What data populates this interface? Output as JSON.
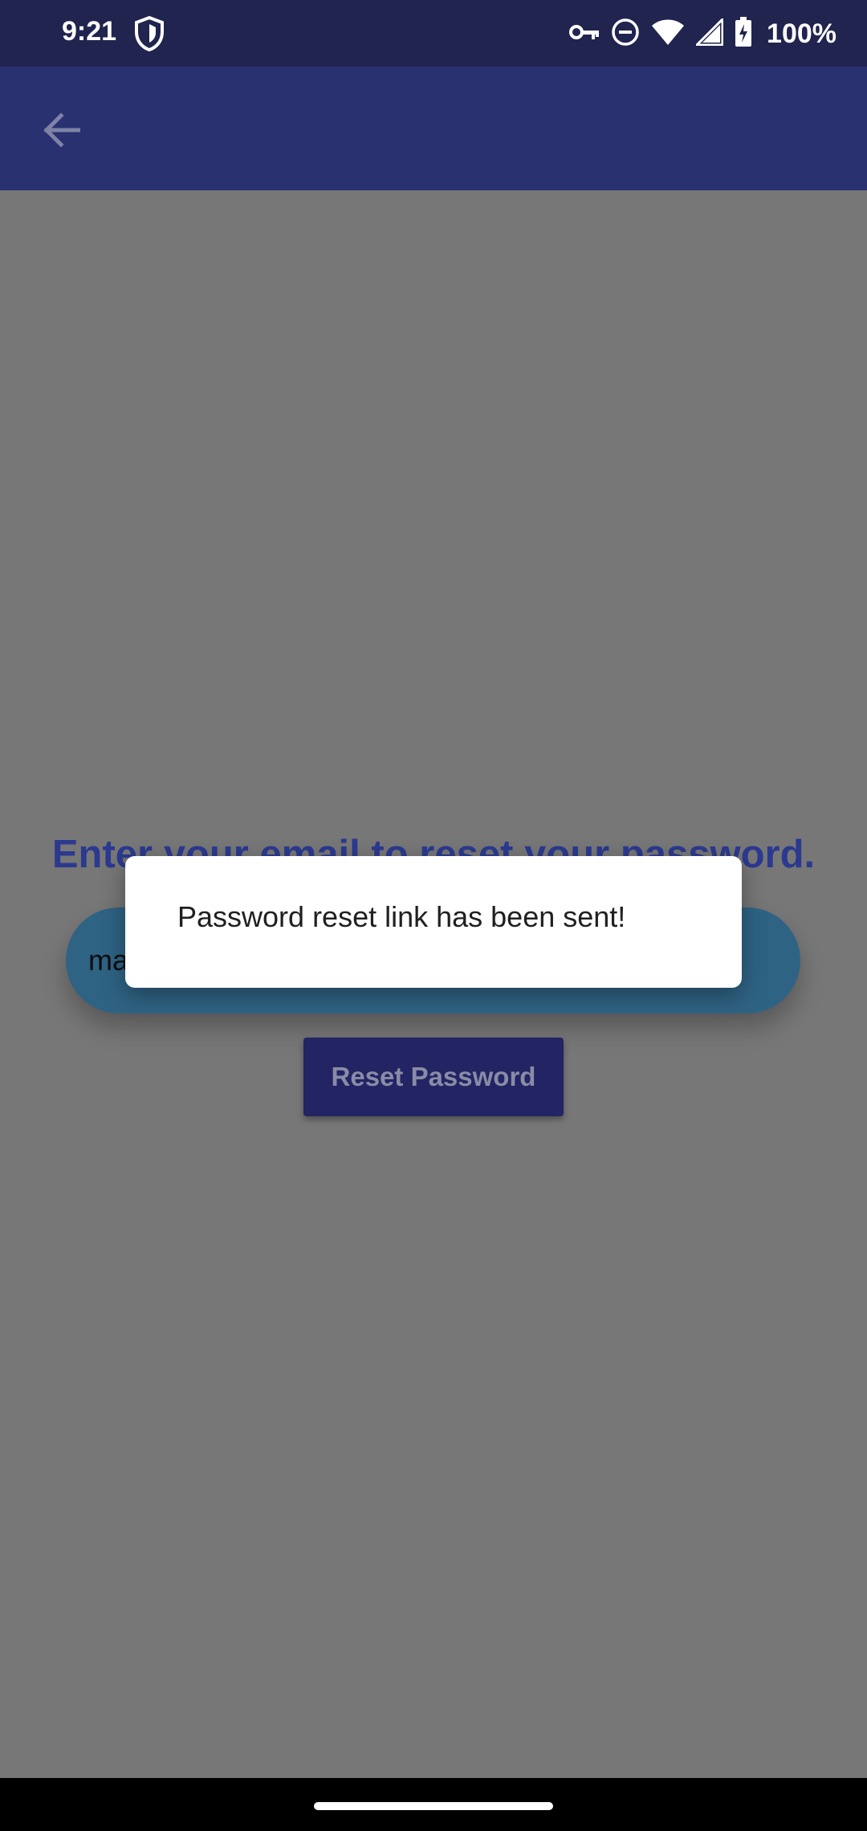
{
  "status_bar": {
    "time": "9:21",
    "battery_percent": "100%",
    "icons": [
      "shield-icon",
      "vpn-key-icon",
      "do-not-disturb-icon",
      "wifi-icon",
      "signal-icon",
      "battery-charging-icon"
    ]
  },
  "app_bar": {
    "back_icon": "arrow-back-icon"
  },
  "content": {
    "heading": "Enter your email to reset your password.",
    "email_value_visible": "ma",
    "reset_button_label": "Reset Password"
  },
  "dialog": {
    "message": "Password reset link has been sent!"
  },
  "colors": {
    "status_bar": "#20244f",
    "app_bar_dimmed": "#2a3171",
    "scrim_background": "#777777",
    "heading": "#2b3a8f",
    "email_field": "#2f6384",
    "button": "#232463"
  }
}
